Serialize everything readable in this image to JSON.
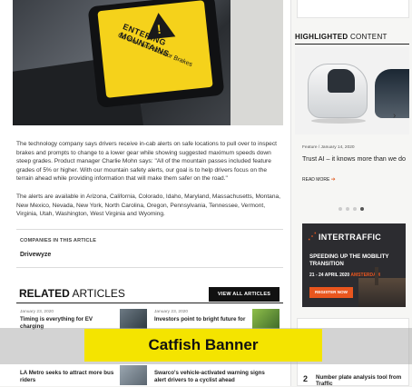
{
  "hero": {
    "screen_title": "ENTERING MOUNTAINS",
    "screen_subtitle": "Go slow and Monitor Brakes"
  },
  "article": {
    "paragraphs": [
      "The technology company says drivers receive in-cab alerts on safe locations to pull over to inspect brakes and prompts to change to a lower gear while showing suggested maximum speeds down steep grades. Product manager Charlie Mohn says: \"All of the mountain passes included feature grades of 5% or higher. With our mountain safety alerts, our goal is to help drivers focus on the terrain ahead while providing information that will make them safer on the road.\"",
      "The alerts are available in Arizona, California, Colorado, Idaho, Maryland, Massachusetts, Montana, New Mexico, Nevada, New York, North Carolina, Oregon, Pennsylvania, Tennessee, Vermont, Virginia, Utah, Washington, West Virginia and Wyoming."
    ],
    "companies_label": "COMPANIES IN THIS ARTICLE",
    "company": "Drivewyze"
  },
  "related": {
    "title_bold": "RELATED",
    "title_rest": " ARTICLES",
    "view_all": "VIEW ALL ARTICLES",
    "items": [
      {
        "date": "January 23, 2020",
        "headline": "Timing is everything for EV charging"
      },
      {
        "date": "January 23, 2020",
        "headline": "Investors point to bright future for"
      },
      {
        "date": "",
        "headline": "LA Metro seeks to attract more bus riders"
      },
      {
        "date": "",
        "headline": "Swarco's vehicle-activated warning signs alert drivers to a cyclist ahead"
      }
    ]
  },
  "sidebar": {
    "highlighted_bold": "HIGHLIGHTED",
    "highlighted_rest": " CONTENT",
    "feature_meta": "Feature / January 14, 2020",
    "feature_headline": "Trust AI – it knows more than we do",
    "read_more": "READ MORE",
    "read_more_arrow": "➔",
    "carousel_arrow": "›",
    "ad": {
      "brand": "INTERTRAFFIC",
      "line1": "SPEEDING UP THE MOBILITY TRANSITION",
      "dates": "21 - 24 APRIL 2020",
      "city": "AMSTERDAM",
      "button": "REGISTER NOW"
    },
    "most_popular": {
      "number": "2",
      "headline": "Number plate analysis tool from Traffic"
    }
  },
  "catfish": {
    "label": "Catfish Banner"
  },
  "colors": {
    "accent": "#e9561e",
    "catfish_bg": "#f4e400",
    "ad_bg": "#2c2c30"
  }
}
